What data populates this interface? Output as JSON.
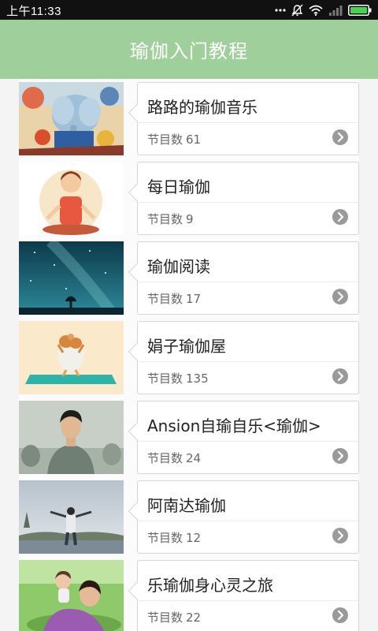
{
  "status_bar": {
    "time": "上午11:33"
  },
  "app_bar": {
    "title": "瑜伽入门教程"
  },
  "count_label": "节目数",
  "programs": [
    {
      "name": "路路的瑜伽音乐",
      "count": "61"
    },
    {
      "name": "每日瑜伽",
      "count": "9"
    },
    {
      "name": "瑜伽阅读",
      "count": "17"
    },
    {
      "name": "娟子瑜伽屋",
      "count": "135"
    },
    {
      "name": "Ansion自瑜自乐<瑜伽>",
      "count": "24"
    },
    {
      "name": "阿南达瑜伽",
      "count": "12"
    },
    {
      "name": "乐瑜伽身心灵之旅",
      "count": "22"
    }
  ],
  "colors": {
    "app_bar": "#9fcf9a",
    "status_bar": "#111111",
    "arrow": "#9a9a9a"
  }
}
